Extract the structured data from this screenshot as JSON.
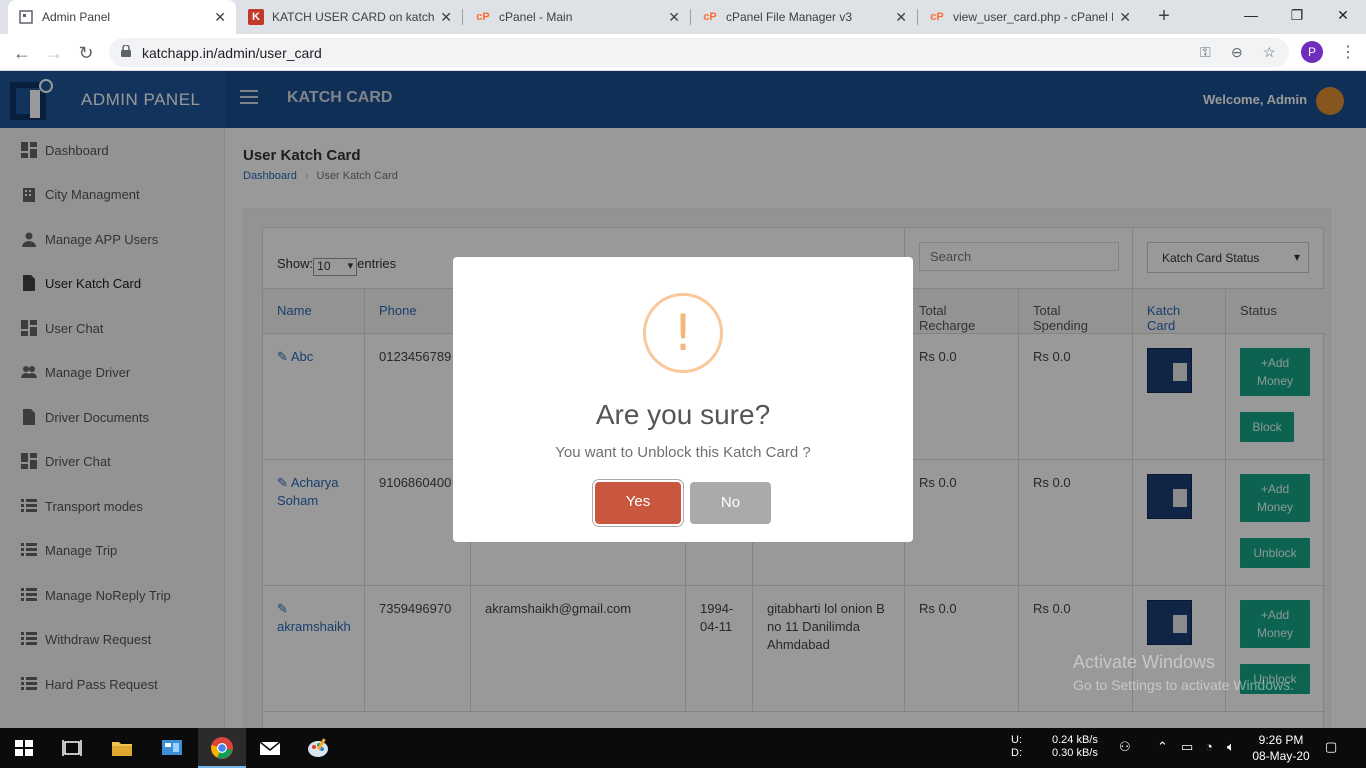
{
  "browser": {
    "tabs": [
      {
        "title": "Admin Panel",
        "active": true
      },
      {
        "title": "KATCH USER CARD on katch ca"
      },
      {
        "title": "cPanel - Main"
      },
      {
        "title": "cPanel File Manager v3"
      },
      {
        "title": "view_user_card.php - cPanel Fi"
      }
    ],
    "url": "katchapp.in/admin/user_card",
    "profile_initial": "P"
  },
  "header": {
    "brand": "ADMIN PANEL",
    "app_title": "KATCH CARD",
    "welcome": "Welcome, Admin"
  },
  "sidebar": {
    "items": [
      {
        "label": "Dashboard"
      },
      {
        "label": "City Managment"
      },
      {
        "label": "Manage APP Users"
      },
      {
        "label": "User Katch Card"
      },
      {
        "label": "User Chat"
      },
      {
        "label": "Manage Driver"
      },
      {
        "label": "Driver Documents"
      },
      {
        "label": "Driver Chat"
      },
      {
        "label": "Transport modes"
      },
      {
        "label": "Manage Trip"
      },
      {
        "label": "Manage NoReply Trip"
      },
      {
        "label": "Withdraw Request"
      },
      {
        "label": "Hard Pass Request"
      }
    ]
  },
  "page": {
    "title": "User Katch Card",
    "breadcrumb_home": "Dashboard",
    "breadcrumb_current": "User Katch Card"
  },
  "table": {
    "show_label": "Show:",
    "show_value": "10",
    "entries_label": "entries",
    "search_placeholder": "Search",
    "status_filter": "Katch Card Status",
    "headers": {
      "name": "Name",
      "phone": "Phone",
      "total_recharge": "Total Recharge",
      "total_spending": "Total Spending",
      "katch_card": "Katch Card",
      "status": "Status"
    },
    "rows": [
      {
        "name": "Abc",
        "phone": "0123456789",
        "email": "",
        "dob": "",
        "address": "",
        "recharge": "Rs 0.0",
        "spending": "Rs 0.0",
        "add_money": "+Add Money",
        "action": "Block"
      },
      {
        "name": "Acharya Soham",
        "phone": "9106860400",
        "email": "",
        "dob": "",
        "address": "",
        "recharge": "Rs 0.0",
        "spending": "Rs 0.0",
        "add_money": "+Add Money",
        "action": "Unblock"
      },
      {
        "name": "akramshaikh",
        "phone": "7359496970",
        "email": "akramshaikh@gmail.com",
        "dob": "1994-04-11",
        "address": "gitabharti lol onion B no 11 Danilimda Ahmdabad",
        "recharge": "Rs 0.0",
        "spending": "Rs 0.0",
        "add_money": "+Add Money",
        "action": "Unblock"
      }
    ]
  },
  "modal": {
    "icon": "!",
    "title": "Are you sure?",
    "text": "You want to Unblock this Katch Card ?",
    "yes": "Yes",
    "no": "No"
  },
  "watermark": {
    "line1": "Activate Windows",
    "line2": "Go to Settings to activate Windows."
  },
  "taskbar": {
    "upload_label": "U:",
    "download_label": "D:",
    "upload_speed": "0.24 kB/s",
    "download_speed": "0.30 kB/s",
    "time": "9:26 PM",
    "date": "08-May-20"
  }
}
